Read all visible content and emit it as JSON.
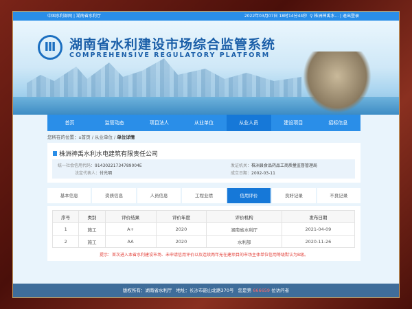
{
  "topbar": {
    "link1": "中国水利部网",
    "sep": "|",
    "link2": "湖南省水利厅",
    "datetime": "2022年03月07日 18时14分44秒",
    "user": "株洲神禹水...",
    "logout": "退出登录"
  },
  "header": {
    "title": "湖南省水利建设市场综合监管系统",
    "subtitle": "COMPREHENSIVE REGULATORY PLATFORM"
  },
  "nav": [
    "首页",
    "监管动态",
    "项目法人",
    "从业单位",
    "从业人员",
    "建设项目",
    "招标信息"
  ],
  "breadcrumb": {
    "prefix": "您所在的位置：",
    "home": "首页",
    "level2": "从业单位",
    "current": "单位详情"
  },
  "company": {
    "name": "株洲神禹水利水电建筑有限责任公司",
    "credit_code_label": "统一社会信用代码：",
    "credit_code": "91430221734789004E",
    "legal_rep_label": "法定代表人：",
    "legal_rep": "付光明",
    "issuer_label": "发证机关：",
    "issuer": "株洲县食品药品工商质量监督管理局",
    "founded_label": "成立日期：",
    "founded": "2002-03-11"
  },
  "tabs": [
    "基本信息",
    "资质信息",
    "人员信息",
    "工程业绩",
    "信用评价",
    "良好记录",
    "不良记录"
  ],
  "table": {
    "headers": [
      "序号",
      "类别",
      "评价结果",
      "评价年度",
      "评价机构",
      "发布日期"
    ],
    "rows": [
      [
        "1",
        "施工",
        "A+",
        "2020",
        "湖南省水利厅",
        "2021-04-09"
      ],
      [
        "2",
        "施工",
        "AA",
        "2020",
        "水利部",
        "2020-11-26"
      ]
    ]
  },
  "tip": "提示：首次进入本省水利建设市场、未申请信用评价以及连续两年无在建项目的市场主体单位信用等级默认为B级。",
  "footer": {
    "copyright": "版权所有：湖南省水利厅",
    "address": "地址：长沙市韶山北路370号",
    "visit_pre": "您是第",
    "visit_count": "666659",
    "visit_post": "位访问者"
  }
}
